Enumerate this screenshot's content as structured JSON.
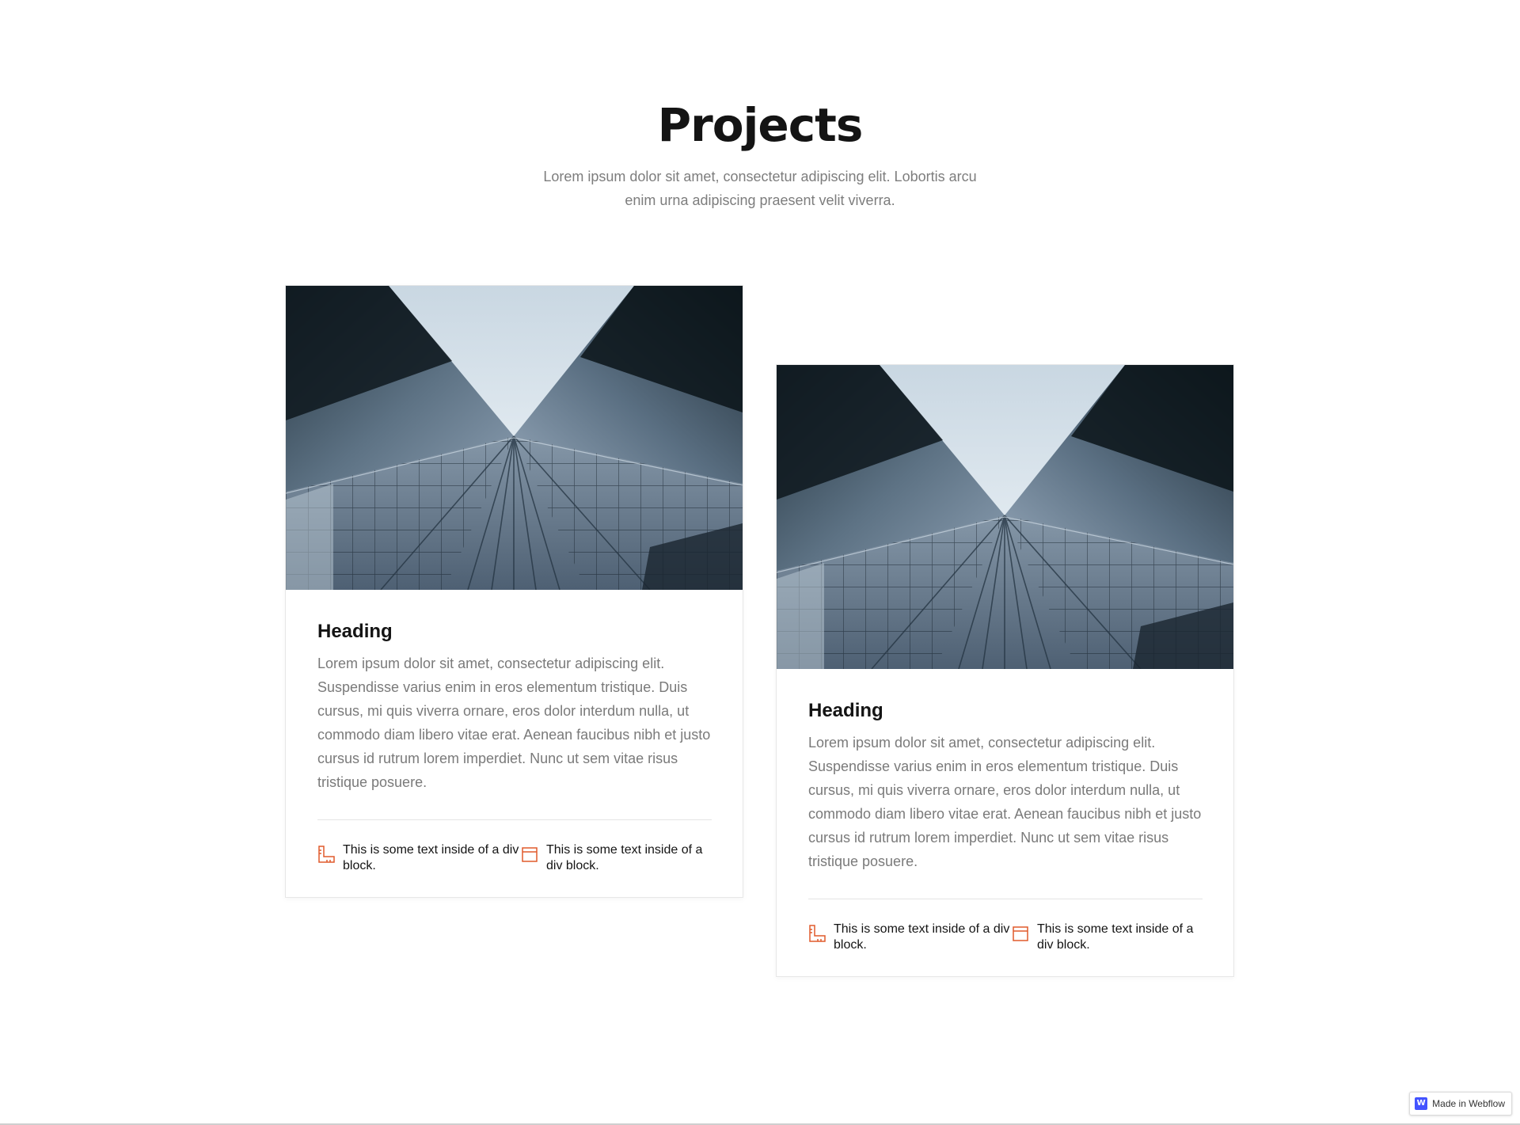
{
  "header": {
    "title": "Projects",
    "subtitle": "Lorem ipsum dolor sit amet, consectetur adipiscing elit. Lobortis arcu enim urna adipiscing praesent velit viverra."
  },
  "cards": [
    {
      "heading": "Heading",
      "text": "Lorem ipsum dolor sit amet, consectetur adipiscing elit. Suspendisse varius enim in eros elementum tristique. Duis cursus, mi quis viverra ornare, eros dolor interdum nulla, ut commodo diam libero vitae erat. Aenean faucibus nibh et justo cursus id rutrum lorem imperdiet. Nunc ut sem vitae risus tristique posuere.",
      "features": [
        {
          "icon": "ruler-icon",
          "text": "This is some text inside of a div block."
        },
        {
          "icon": "calendar-icon",
          "text": "This is some text inside of a div block."
        }
      ]
    },
    {
      "heading": "Heading",
      "text": "Lorem ipsum dolor sit amet, consectetur adipiscing elit. Suspendisse varius enim in eros elementum tristique. Duis cursus, mi quis viverra ornare, eros dolor interdum nulla, ut commodo diam libero vitae erat. Aenean faucibus nibh et justo cursus id rutrum lorem imperdiet. Nunc ut sem vitae risus tristique posuere.",
      "features": [
        {
          "icon": "ruler-icon",
          "text": "This is some text inside of a div block."
        },
        {
          "icon": "calendar-icon",
          "text": "This is some text inside of a div block."
        }
      ]
    }
  ],
  "badge": {
    "logo": "W",
    "label": "Made in Webflow"
  },
  "colors": {
    "accent": "#e05a2b",
    "heading": "#141414",
    "body_text": "#7a7a7a"
  }
}
